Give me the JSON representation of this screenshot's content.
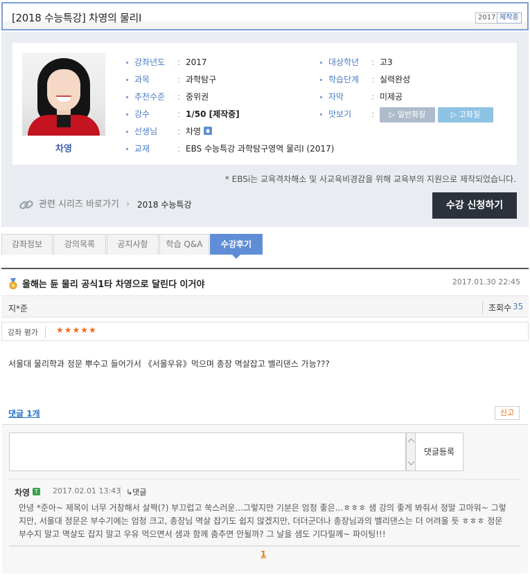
{
  "header": {
    "title": "[2018 수능특강] 차영의 물리I",
    "tag_year": "2017",
    "tag_status": "제작중"
  },
  "teacher": {
    "name": "차영"
  },
  "info": {
    "year_label": "강좌년도",
    "year_value": "2017",
    "target_label": "대상학년",
    "target_value": "고3",
    "subject_label": "과목",
    "subject_value": "과학탐구",
    "stage_label": "학습단계",
    "stage_value": "실력완성",
    "level_label": "추천수준",
    "level_value": "중위권",
    "caption_label": "자막",
    "caption_value": "미제공",
    "count_label": "강수",
    "count_value": "1/50 [제작중]",
    "preview_label": "맛보기",
    "preview_general": "▷ 일반화질",
    "preview_hd": "▷ 고화질",
    "teacher_label": "선생님",
    "teacher_value": "차영",
    "book_label": "교재",
    "book_value": "EBS 수능특강 과학탐구영역 물리I (2017)",
    "separator": ":"
  },
  "notice": "* EBSi는 교육격차해소 및 사교육비경감을 위해 교육부의 지원으로 제작되었습니다.",
  "series": {
    "label": "관련 시리즈 바로가기",
    "arrow": "›",
    "value": "2018 수능특강"
  },
  "enroll_button": "수강 신청하기",
  "tabs": [
    "강좌정보",
    "강의목록",
    "공지사항",
    "학습 Q&A",
    "수강후기"
  ],
  "post": {
    "title": "올해는 듄 물리 공식1타 차영으로 달린다 이거야",
    "date": "2017.01.30 22:45",
    "author": "지*준",
    "views_label": "조회수",
    "views_value": "35",
    "rating_label": "강좌 평가",
    "stars": "★★★★★",
    "body": "서울대 물리학과 정문 뿌수고 들어가서 《서울우유》먹으며 총장 멱살잡고 밸리댄스 가능???"
  },
  "comments": {
    "header": "댓글 1개",
    "report": "신고",
    "submit": "댓글등록",
    "reply": {
      "author": "차영",
      "badge": "T",
      "date": "2017.02.01 13:43",
      "reply_link": "↳댓글",
      "text": "안녕 *준아~ 제목이 너무 거창해서 살짝(?) 부끄럽고 쑥스러운...그렇지만 기분은 엄청 좋은...ㅎㅎㅎ 샘 강의 좋게 봐줘서 정말 고마워~ 그렇지만, 서울대 정문은 부수기에는 엄청 크고, 총장님 멱살 잡기도 쉽지 않겠지만, 더더군더나 총장님과의 밸리댄스는 더 어려울 듯 ㅎㅎㅎ 정문 부수지 말고 멱살도 잡지 말고 우유 먹으면서 샘과 함께 춤추면 안될까? 그 날을 샘도 기다릴께~ 파이팅!!!"
    },
    "page": "1"
  },
  "colors": {
    "accent_blue": "#5f8ed6",
    "label_blue": "#4a7cc0",
    "star_orange": "#f26a1b",
    "enroll_bg": "#2b323c"
  }
}
